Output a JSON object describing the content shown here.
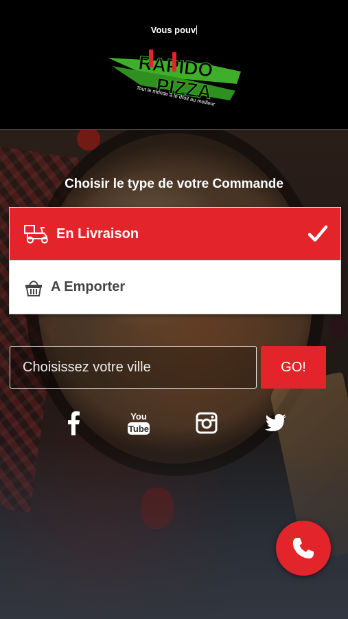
{
  "header": {
    "typing_text": "Vous pouv",
    "logo_text_top": "RAPIDO",
    "logo_text_bottom": "PIZZA",
    "logo_tagline": "Tout le monde à le droit au meilleur"
  },
  "order": {
    "prompt": "Choisir le type de votre Commande",
    "options": [
      {
        "label": "En Livraison",
        "icon": "delivery-scooter-icon",
        "selected": true
      },
      {
        "label": "A Emporter",
        "icon": "basket-icon",
        "selected": false
      }
    ]
  },
  "city": {
    "placeholder": "Choisissez votre ville",
    "go_label": "GO!"
  },
  "social": [
    "facebook-icon",
    "youtube-icon",
    "instagram-icon",
    "twitter-icon"
  ],
  "social_youtube_text": "You\nTube",
  "colors": {
    "accent": "#e3242b",
    "logo_green": "#3fae2a"
  },
  "call_button_icon": "phone-icon"
}
